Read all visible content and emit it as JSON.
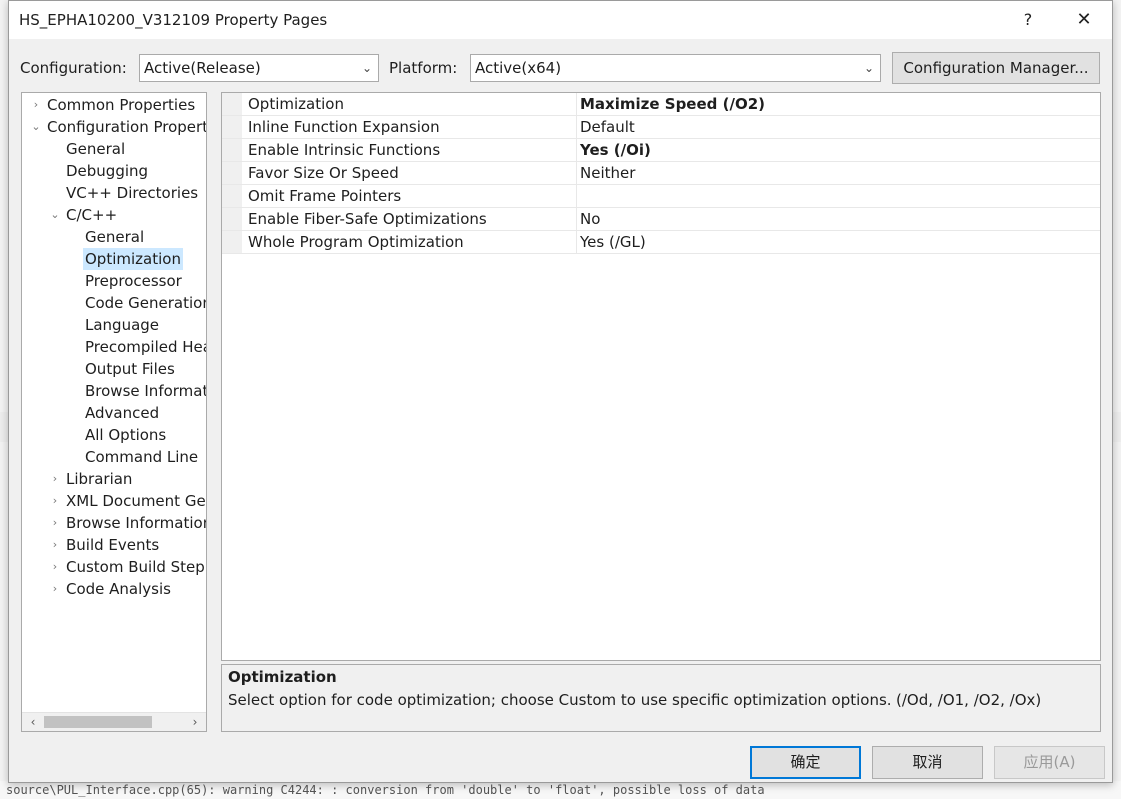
{
  "window": {
    "title": "HS_EPHA10200_V312109 Property Pages",
    "help_glyph": "?",
    "close_glyph": "✕"
  },
  "background": {
    "status_line": "source\\PUL_Interface.cpp(65): warning C4244:     : conversion from 'double' to 'float', possible loss of data"
  },
  "toolbar": {
    "configuration_label": "Configuration:",
    "configuration_value": "Active(Release)",
    "platform_label": "Platform:",
    "platform_value": "Active(x64)",
    "config_manager_label": "Configuration Manager..."
  },
  "tree": {
    "items": [
      {
        "label": "Common Properties",
        "expander": "›"
      },
      {
        "label": "Configuration Propert",
        "expander": "⌄"
      },
      {
        "label": "General"
      },
      {
        "label": "Debugging"
      },
      {
        "label": "VC++ Directories"
      },
      {
        "label": "C/C++",
        "expander": "⌄"
      },
      {
        "label": "General"
      },
      {
        "label": "Optimization"
      },
      {
        "label": "Preprocessor"
      },
      {
        "label": "Code Generation"
      },
      {
        "label": "Language"
      },
      {
        "label": "Precompiled Hea"
      },
      {
        "label": "Output Files"
      },
      {
        "label": "Browse Informat"
      },
      {
        "label": "Advanced"
      },
      {
        "label": "All Options"
      },
      {
        "label": "Command Line"
      },
      {
        "label": "Librarian",
        "expander": "›"
      },
      {
        "label": "XML Document Ger",
        "expander": "›"
      },
      {
        "label": "Browse Information",
        "expander": "›"
      },
      {
        "label": "Build Events",
        "expander": "›"
      },
      {
        "label": "Custom Build Step",
        "expander": "›"
      },
      {
        "label": "Code Analysis",
        "expander": "›"
      }
    ],
    "scroll_left": "‹",
    "scroll_right": "›"
  },
  "properties": [
    {
      "name": "Optimization",
      "value": "Maximize Speed (/O2)",
      "bold": true
    },
    {
      "name": "Inline Function Expansion",
      "value": "Default",
      "bold": false
    },
    {
      "name": "Enable Intrinsic Functions",
      "value": "Yes (/Oi)",
      "bold": true
    },
    {
      "name": "Favor Size Or Speed",
      "value": "Neither",
      "bold": false
    },
    {
      "name": "Omit Frame Pointers",
      "value": "",
      "bold": false
    },
    {
      "name": "Enable Fiber-Safe Optimizations",
      "value": "No",
      "bold": false
    },
    {
      "name": "Whole Program Optimization",
      "value": "Yes (/GL)",
      "bold": false
    }
  ],
  "description": {
    "title": "Optimization",
    "text": "Select option for code optimization; choose Custom to use specific optimization options.",
    "flags": "(/Od, /O1, /O2, /Ox)"
  },
  "buttons": {
    "ok": "确定",
    "cancel": "取消",
    "apply": "应用(A)"
  },
  "colors": {
    "selection": "#cce8ff",
    "primary_border": "#0078d7",
    "dialog_bg": "#f0f0f0"
  }
}
